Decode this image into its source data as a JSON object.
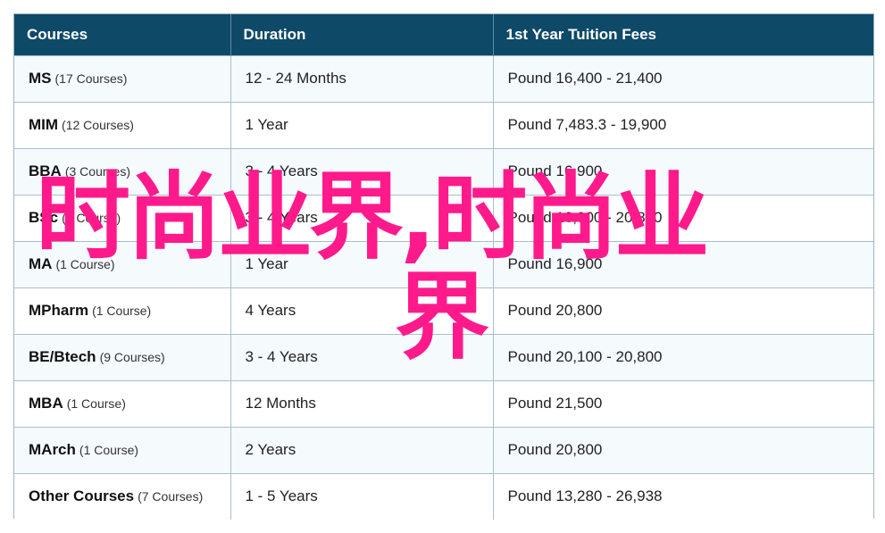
{
  "table": {
    "headers": [
      "Courses",
      "Duration",
      "1st Year Tuition Fees"
    ],
    "rows": [
      {
        "name": "MS",
        "count": "(17 Courses)",
        "duration": "12 - 24 Months",
        "fees": "Pound 16,400 - 21,400"
      },
      {
        "name": "MIM",
        "count": "(12 Courses)",
        "duration": "1 Year",
        "fees": "Pound 7,483.3 - 19,900"
      },
      {
        "name": "BBA",
        "count": "(3 Courses)",
        "duration": "3 - 4 Years",
        "fees": "Pound 16,900"
      },
      {
        "name": "BSc",
        "count": "(1 Course)",
        "duration": "3 - 4 Years",
        "fees": "Pound 16,900 - 20,800"
      },
      {
        "name": "MA",
        "count": "(1 Course)",
        "duration": "1 Year",
        "fees": "Pound 16,900"
      },
      {
        "name": "MPharm",
        "count": "(1 Course)",
        "duration": "4 Years",
        "fees": "Pound 20,800"
      },
      {
        "name": "BE/Btech",
        "count": "(9 Courses)",
        "duration": "3 - 4 Years",
        "fees": "Pound 20,100 - 20,800"
      },
      {
        "name": "MBA",
        "count": "(1 Course)",
        "duration": "12 Months",
        "fees": "Pound 21,500"
      },
      {
        "name": "MArch",
        "count": "(1 Course)",
        "duration": "2 Years",
        "fees": "Pound 20,800"
      },
      {
        "name": "Other Courses",
        "count": "(7 Courses)",
        "duration": "1 - 5 Years",
        "fees": "Pound 13,280 - 26,938"
      }
    ]
  },
  "overlay": {
    "line1": "时尚业界,时尚业",
    "line2": "界"
  },
  "colors": {
    "header_bg": "#0e4a68",
    "overlay_text": "#ff1a8c"
  }
}
